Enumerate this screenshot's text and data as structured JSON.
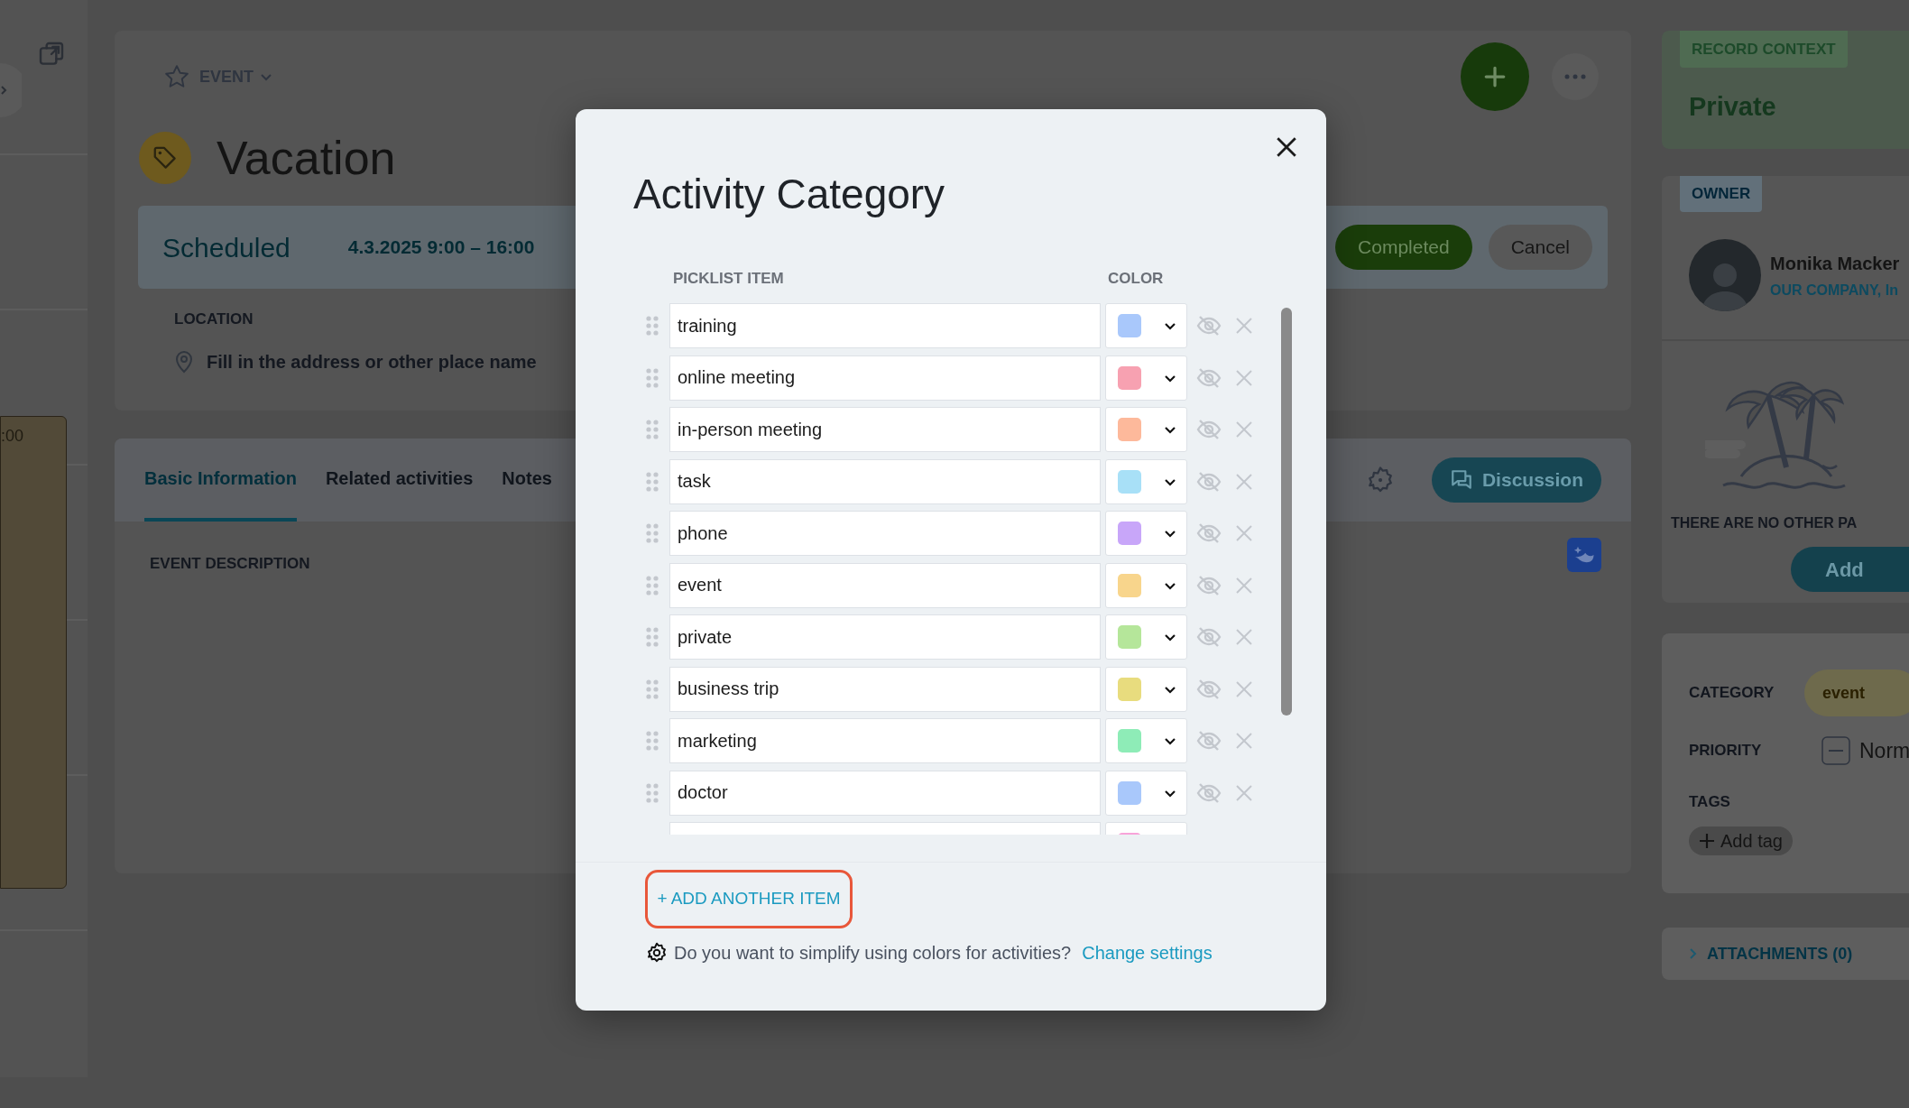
{
  "calendar": {
    "event_time": ":00"
  },
  "event": {
    "type_label": "EVENT",
    "title": "Vacation",
    "status": "Scheduled",
    "date_range": "4.3.2025 9:00 – 16:00",
    "status_actions": [
      {
        "label": "Completed",
        "kind": "primary"
      },
      {
        "label": "Cancel",
        "kind": "secondary"
      }
    ],
    "location": {
      "label": "LOCATION",
      "placeholder": "Fill in the address or other place name"
    }
  },
  "tabs": [
    {
      "label": "Basic Information",
      "selected": true
    },
    {
      "label": "Related activities",
      "selected": false
    },
    {
      "label": "Notes",
      "selected": false
    }
  ],
  "discussion_button": "Discussion",
  "event_description": {
    "label": "EVENT DESCRIPTION"
  },
  "sidebar": {
    "record_context": {
      "badge": "RECORD CONTEXT",
      "value": "Private"
    },
    "owner": {
      "badge": "OWNER",
      "name": "Monika Macker",
      "company": "OUR COMPANY, In"
    },
    "participants": {
      "empty_text": "THERE ARE NO OTHER PA",
      "add_button": "Add"
    },
    "details": [
      {
        "label": "CATEGORY",
        "value": "event",
        "kind": "pill"
      },
      {
        "label": "PRIORITY",
        "value": "Norm",
        "kind": "priority"
      }
    ],
    "tags": {
      "label": "TAGS",
      "add_button": "Add tag"
    },
    "attachments": "ATTACHMENTS (0)"
  },
  "dialog": {
    "title": "Activity Category",
    "columns": [
      "PICKLIST ITEM",
      "COLOR"
    ],
    "items": [
      {
        "label": "training",
        "color": "#a9c8fb"
      },
      {
        "label": "online meeting",
        "color": "#f7a1b1"
      },
      {
        "label": "in-person meeting",
        "color": "#fdb99b"
      },
      {
        "label": "task",
        "color": "#a8e0f7"
      },
      {
        "label": "phone",
        "color": "#c8a6f9"
      },
      {
        "label": "event",
        "color": "#f8d58c"
      },
      {
        "label": "private",
        "color": "#b5e69a"
      },
      {
        "label": "business trip",
        "color": "#e8dc7e"
      },
      {
        "label": "marketing",
        "color": "#8eecb7"
      },
      {
        "label": "doctor",
        "color": "#a9c8fb"
      },
      {
        "color": "#f8a3d9"
      }
    ],
    "add_button": "+ ADD ANOTHER ITEM",
    "hint": "Do you want to simplify using colors for activities?",
    "hint_link": "Change settings"
  }
}
